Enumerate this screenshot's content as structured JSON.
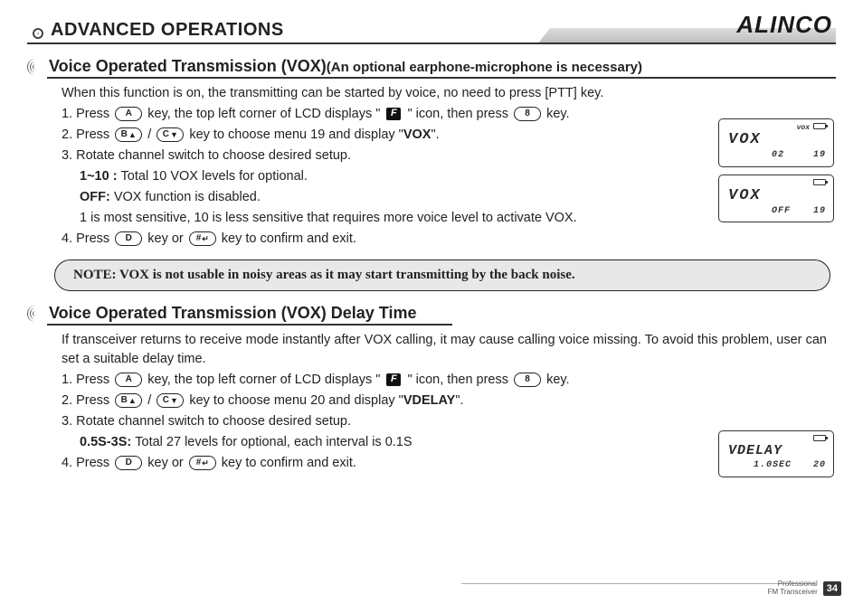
{
  "header": {
    "section_title": "ADVANCED OPERATIONS",
    "brand": "ALINCO"
  },
  "sec1": {
    "title": "Voice Operated Transmission (VOX)",
    "subtitle": "(An optional earphone-microphone is necessary)",
    "intro": "When this function is on, the transmitting can be started by voice, no need to press [PTT] key.",
    "step1_a": "1. Press ",
    "step1_b": " key, the top left corner of LCD displays \" ",
    "step1_c": " \" icon, then press ",
    "step1_d": " key.",
    "step2_a": "2. Press ",
    "step2_b": "/",
    "step2_c": "  key to choose menu 19 and display \"",
    "step2_menu": "VOX",
    "step2_d": "\".",
    "step3": "3. Rotate channel switch to choose desired setup.",
    "step3_sub1_a": "1~10 : ",
    "step3_sub1_b": "Total 10 VOX levels for optional.",
    "step3_sub2_a": "OFF: ",
    "step3_sub2_b": "VOX function is disabled.",
    "step3_sub3": "1 is most sensitive, 10 is less sensitive that requires more voice level to activate VOX.",
    "step4_a": "4. Press ",
    "step4_b": " key or ",
    "step4_c": " key to confirm and exit.",
    "note": "NOTE: VOX is not usable in noisy areas as it may start transmitting by the back noise."
  },
  "sec2": {
    "title": "Voice Operated Transmission (VOX) Delay Time",
    "intro": "If transceiver returns to receive mode instantly after VOX calling, it may cause calling voice missing. To avoid this problem, user can set a suitable delay time.",
    "step1_a": "1. Press ",
    "step1_b": " key, the top left corner of LCD displays \" ",
    "step1_c": " \" icon, then press ",
    "step1_d": " key.",
    "step2_a": "2. Press ",
    "step2_b": " /",
    "step2_c": " key to choose menu 20 and display \"",
    "step2_menu": "VDELAY",
    "step2_d": "\".",
    "step3": "3. Rotate channel switch to choose desired setup.",
    "step3_sub1_a": "0.5S-3S: ",
    "step3_sub1_b": "Total 27 levels for optional, each interval is 0.1S",
    "step4_a": "4. Press ",
    "step4_b": " key or ",
    "step4_c": " key to confirm and exit."
  },
  "keys": {
    "A": "A",
    "B_up": "B",
    "C_down": "C",
    "D": "D",
    "eight": "8",
    "hash": "#",
    "F": "F"
  },
  "lcd1": {
    "icon": "vox",
    "main": "VOX",
    "val": "02",
    "menu": "19"
  },
  "lcd2": {
    "icon": "",
    "main": "VOX",
    "val": "OFF",
    "menu": "19"
  },
  "lcd3": {
    "icon": "",
    "main": "VDELAY",
    "val": "1.0SEC",
    "menu": "20"
  },
  "footer": {
    "line1": "Professional",
    "line2": "FM Transceiver",
    "page": "34"
  }
}
